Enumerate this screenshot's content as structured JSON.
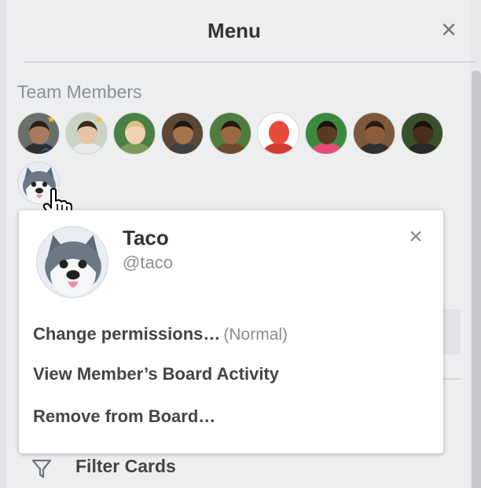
{
  "header": {
    "title": "Menu",
    "close_icon": "close-icon"
  },
  "team_members": {
    "title": "Team Members",
    "avatars": [
      {
        "name": "member-1",
        "skin": "#a97a5d",
        "hair": "#2a1f18",
        "bg": "#6b6f6a",
        "shirt": "#2f2f2f",
        "admin": true,
        "badge": "chevron-up-icon"
      },
      {
        "name": "member-2",
        "skin": "#e7c4a8",
        "hair": "#3a2a20",
        "bg": "#c9d4c4",
        "shirt": "#e9e9e9",
        "admin": true
      },
      {
        "name": "member-3",
        "skin": "#f1d0b3",
        "hair": "#d8c08a",
        "bg": "#4b7f44",
        "shirt": "#7c9b5a"
      },
      {
        "name": "member-4",
        "skin": "#a4724f",
        "hair": "#1d1510",
        "bg": "#5a4735",
        "shirt": "#3f3f3f"
      },
      {
        "name": "member-5",
        "skin": "#9b6846",
        "hair": "#24170f",
        "bg": "#4e7d3f",
        "shirt": "#6e4c2a"
      },
      {
        "name": "member-6",
        "skin": "#e74b3c",
        "hair": "#e74b3c",
        "bg": "#ffffff",
        "shirt": "#d23b2d"
      },
      {
        "name": "member-7",
        "skin": "#5a3a24",
        "hair": "#1b120c",
        "bg": "#3a8a3e",
        "shirt": "#e44d7a"
      },
      {
        "name": "member-8",
        "skin": "#8c5d3c",
        "hair": "#2a1a10",
        "bg": "#7a5a3a",
        "shirt": "#2f2f2f"
      },
      {
        "name": "member-9",
        "skin": "#4a2e1c",
        "hair": "#1a120c",
        "bg": "#39502c",
        "shirt": "#2a2a2a"
      }
    ],
    "selected": "taco"
  },
  "popover": {
    "name": "Taco",
    "username": "@taco",
    "items": [
      {
        "label": "Change permissions…",
        "hint": "(Normal)"
      },
      {
        "label": "View Member’s Board Activity"
      },
      {
        "label": "Remove from Board…"
      }
    ]
  },
  "filter": {
    "label": "Filter Cards",
    "icon": "filter-icon"
  },
  "colors": {
    "background": "#edeef0",
    "popover": "#ffffff",
    "muted": "#8b8f94",
    "admin_star": "#f2c11c"
  }
}
